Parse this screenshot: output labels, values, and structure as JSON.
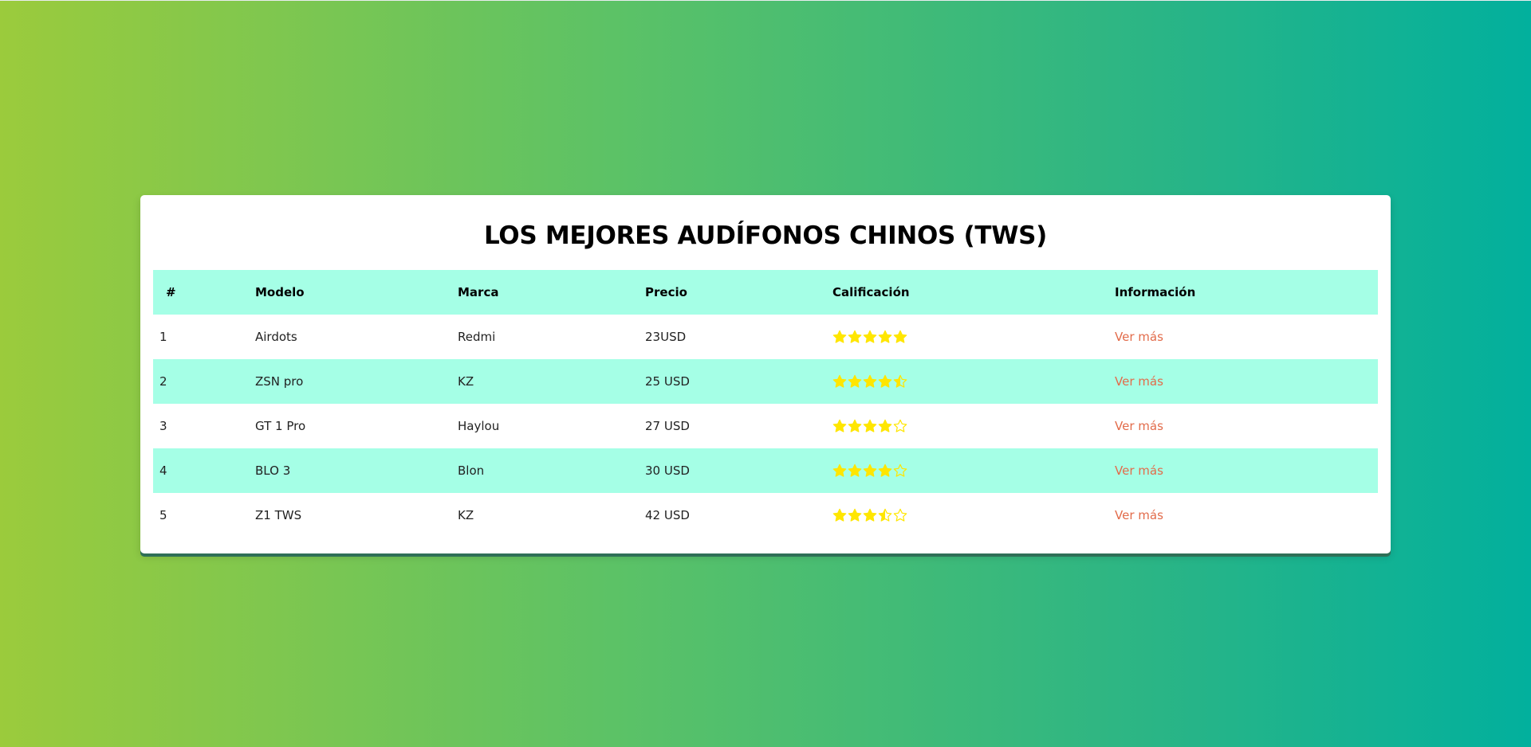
{
  "title": "LOS MEJORES AUDÍFONOS CHINOS (TWS)",
  "colors": {
    "star": "#ffe600",
    "header_bg": "#a5ffe6",
    "link": "#e26b4a"
  },
  "table": {
    "headers": [
      "#",
      "Modelo",
      "Marca",
      "Precio",
      "Calificación",
      "Información"
    ],
    "rows": [
      {
        "num": "1",
        "modelo": "Airdots",
        "marca": "Redmi",
        "precio": "23USD",
        "rating": 5,
        "info": "Ver más"
      },
      {
        "num": "2",
        "modelo": "ZSN pro",
        "marca": "KZ",
        "precio": "25 USD",
        "rating": 4.5,
        "info": "Ver más"
      },
      {
        "num": "3",
        "modelo": "GT 1 Pro",
        "marca": "Haylou",
        "precio": "27 USD",
        "rating": 4,
        "info": "Ver más"
      },
      {
        "num": "4",
        "modelo": "BLO 3",
        "marca": "Blon",
        "precio": "30 USD",
        "rating": 4,
        "info": "Ver más"
      },
      {
        "num": "5",
        "modelo": "Z1 TWS",
        "marca": "KZ",
        "precio": "42 USD",
        "rating": 3.5,
        "info": "Ver más"
      }
    ]
  }
}
